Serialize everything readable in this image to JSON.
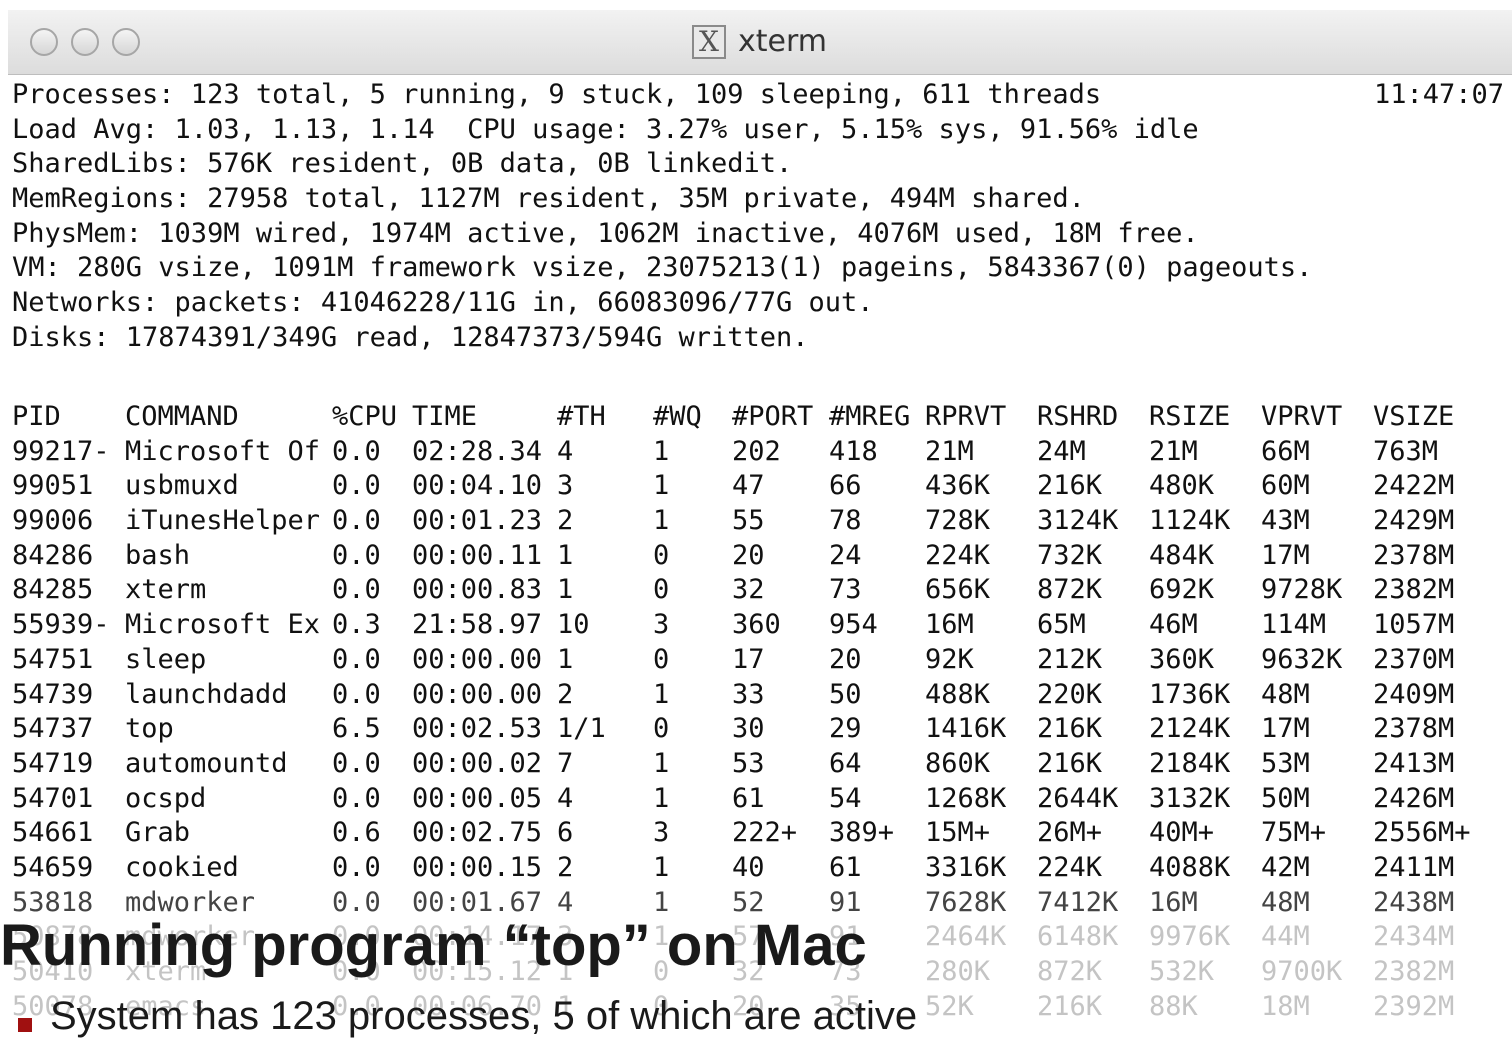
{
  "window": {
    "title": "xterm"
  },
  "clock": "11:47:07",
  "summary_lines": [
    "Processes: 123 total, 5 running, 9 stuck, 109 sleeping, 611 threads",
    "Load Avg: 1.03, 1.13, 1.14  CPU usage: 3.27% user, 5.15% sys, 91.56% idle",
    "SharedLibs: 576K resident, 0B data, 0B linkedit.",
    "MemRegions: 27958 total, 1127M resident, 35M private, 494M shared.",
    "PhysMem: 1039M wired, 1974M active, 1062M inactive, 4076M used, 18M free.",
    "VM: 280G vsize, 1091M framework vsize, 23075213(1) pageins, 5843367(0) pageouts.",
    "Networks: packets: 41046228/11G in, 66083096/77G out.",
    "Disks: 17874391/349G read, 12847373/594G written."
  ],
  "table": {
    "headers": [
      "PID",
      "COMMAND",
      "%CPU",
      "TIME",
      "#TH",
      "#WQ",
      "#PORT",
      "#MREG",
      "RPRVT",
      "RSHRD",
      "RSIZE",
      "VPRVT",
      "VSIZE"
    ],
    "rows": [
      [
        "99217-",
        "Microsoft Of",
        "0.0",
        "02:28.34",
        "4",
        "1",
        "202",
        "418",
        "21M",
        "24M",
        "21M",
        "66M",
        "763M"
      ],
      [
        "99051",
        "usbmuxd",
        "0.0",
        "00:04.10",
        "3",
        "1",
        "47",
        "66",
        "436K",
        "216K",
        "480K",
        "60M",
        "2422M"
      ],
      [
        "99006",
        "iTunesHelper",
        "0.0",
        "00:01.23",
        "2",
        "1",
        "55",
        "78",
        "728K",
        "3124K",
        "1124K",
        "43M",
        "2429M"
      ],
      [
        "84286",
        "bash",
        "0.0",
        "00:00.11",
        "1",
        "0",
        "20",
        "24",
        "224K",
        "732K",
        "484K",
        "17M",
        "2378M"
      ],
      [
        "84285",
        "xterm",
        "0.0",
        "00:00.83",
        "1",
        "0",
        "32",
        "73",
        "656K",
        "872K",
        "692K",
        "9728K",
        "2382M"
      ],
      [
        "55939-",
        "Microsoft Ex",
        "0.3",
        "21:58.97",
        "10",
        "3",
        "360",
        "954",
        "16M",
        "65M",
        "46M",
        "114M",
        "1057M"
      ],
      [
        "54751",
        "sleep",
        "0.0",
        "00:00.00",
        "1",
        "0",
        "17",
        "20",
        "92K",
        "212K",
        "360K",
        "9632K",
        "2370M"
      ],
      [
        "54739",
        "launchdadd",
        "0.0",
        "00:00.00",
        "2",
        "1",
        "33",
        "50",
        "488K",
        "220K",
        "1736K",
        "48M",
        "2409M"
      ],
      [
        "54737",
        "top",
        "6.5",
        "00:02.53",
        "1/1",
        "0",
        "30",
        "29",
        "1416K",
        "216K",
        "2124K",
        "17M",
        "2378M"
      ],
      [
        "54719",
        "automountd",
        "0.0",
        "00:00.02",
        "7",
        "1",
        "53",
        "64",
        "860K",
        "216K",
        "2184K",
        "53M",
        "2413M"
      ],
      [
        "54701",
        "ocspd",
        "0.0",
        "00:00.05",
        "4",
        "1",
        "61",
        "54",
        "1268K",
        "2644K",
        "3132K",
        "50M",
        "2426M"
      ],
      [
        "54661",
        "Grab",
        "0.6",
        "00:02.75",
        "6",
        "3",
        "222+",
        "389+",
        "15M+",
        "26M+",
        "40M+",
        "75M+",
        "2556M+"
      ],
      [
        "54659",
        "cookied",
        "0.0",
        "00:00.15",
        "2",
        "1",
        "40",
        "61",
        "3316K",
        "224K",
        "4088K",
        "42M",
        "2411M"
      ],
      [
        "53818",
        "mdworker",
        "0.0",
        "00:01.67",
        "4",
        "1",
        "52",
        "91",
        "7628K",
        "7412K",
        "16M",
        "48M",
        "2438M"
      ],
      [
        "50878",
        "mdworker",
        "0.0",
        "00:14.17",
        "3",
        "1",
        "57",
        "91",
        "2464K",
        "6148K",
        "9976K",
        "44M",
        "2434M"
      ],
      [
        "50410",
        "xterm",
        "0.0",
        "00:15.12",
        "1",
        "0",
        "32",
        "73",
        "280K",
        "872K",
        "532K",
        "9700K",
        "2382M"
      ],
      [
        "50078",
        "emacs",
        "0.0",
        "00:06.70",
        "1",
        "0",
        "20",
        "35",
        "52K",
        "216K",
        "88K",
        "18M",
        "2392M"
      ]
    ]
  },
  "slide": {
    "title": "Running program “top” on Mac",
    "bullets": [
      "System has 123 processes, 5 of which are active"
    ]
  }
}
